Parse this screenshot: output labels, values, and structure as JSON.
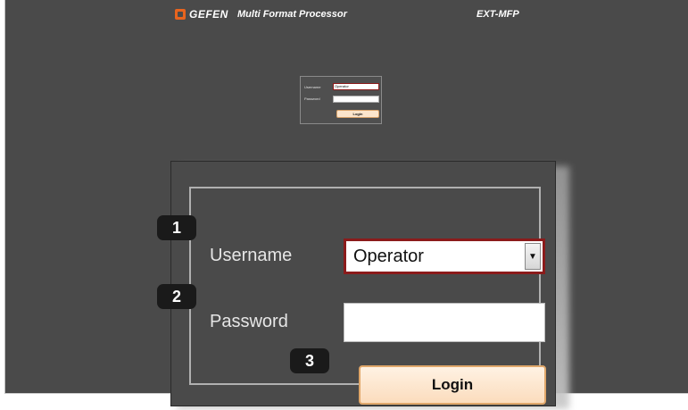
{
  "header": {
    "logo_text": "GEFEN",
    "title": "Multi Format Processor",
    "model": "EXT-MFP"
  },
  "login_preview": {
    "username_label": "Username",
    "username_value": "Operator",
    "password_label": "Password",
    "login_label": "Login"
  },
  "login_zoomed": {
    "username_label": "Username",
    "username_value": "Operator",
    "password_label": "Password",
    "password_value": "",
    "login_label": "Login"
  },
  "callouts": [
    "1",
    "2",
    "3"
  ],
  "colors": {
    "background": "#4a4a4a",
    "logo_accent": "#e8641e",
    "select_border": "#8b1b1b",
    "login_button": "#fce5cc"
  },
  "icons": {
    "logo": "gefen-logo-icon",
    "dropdown": "chevron-down-icon"
  }
}
